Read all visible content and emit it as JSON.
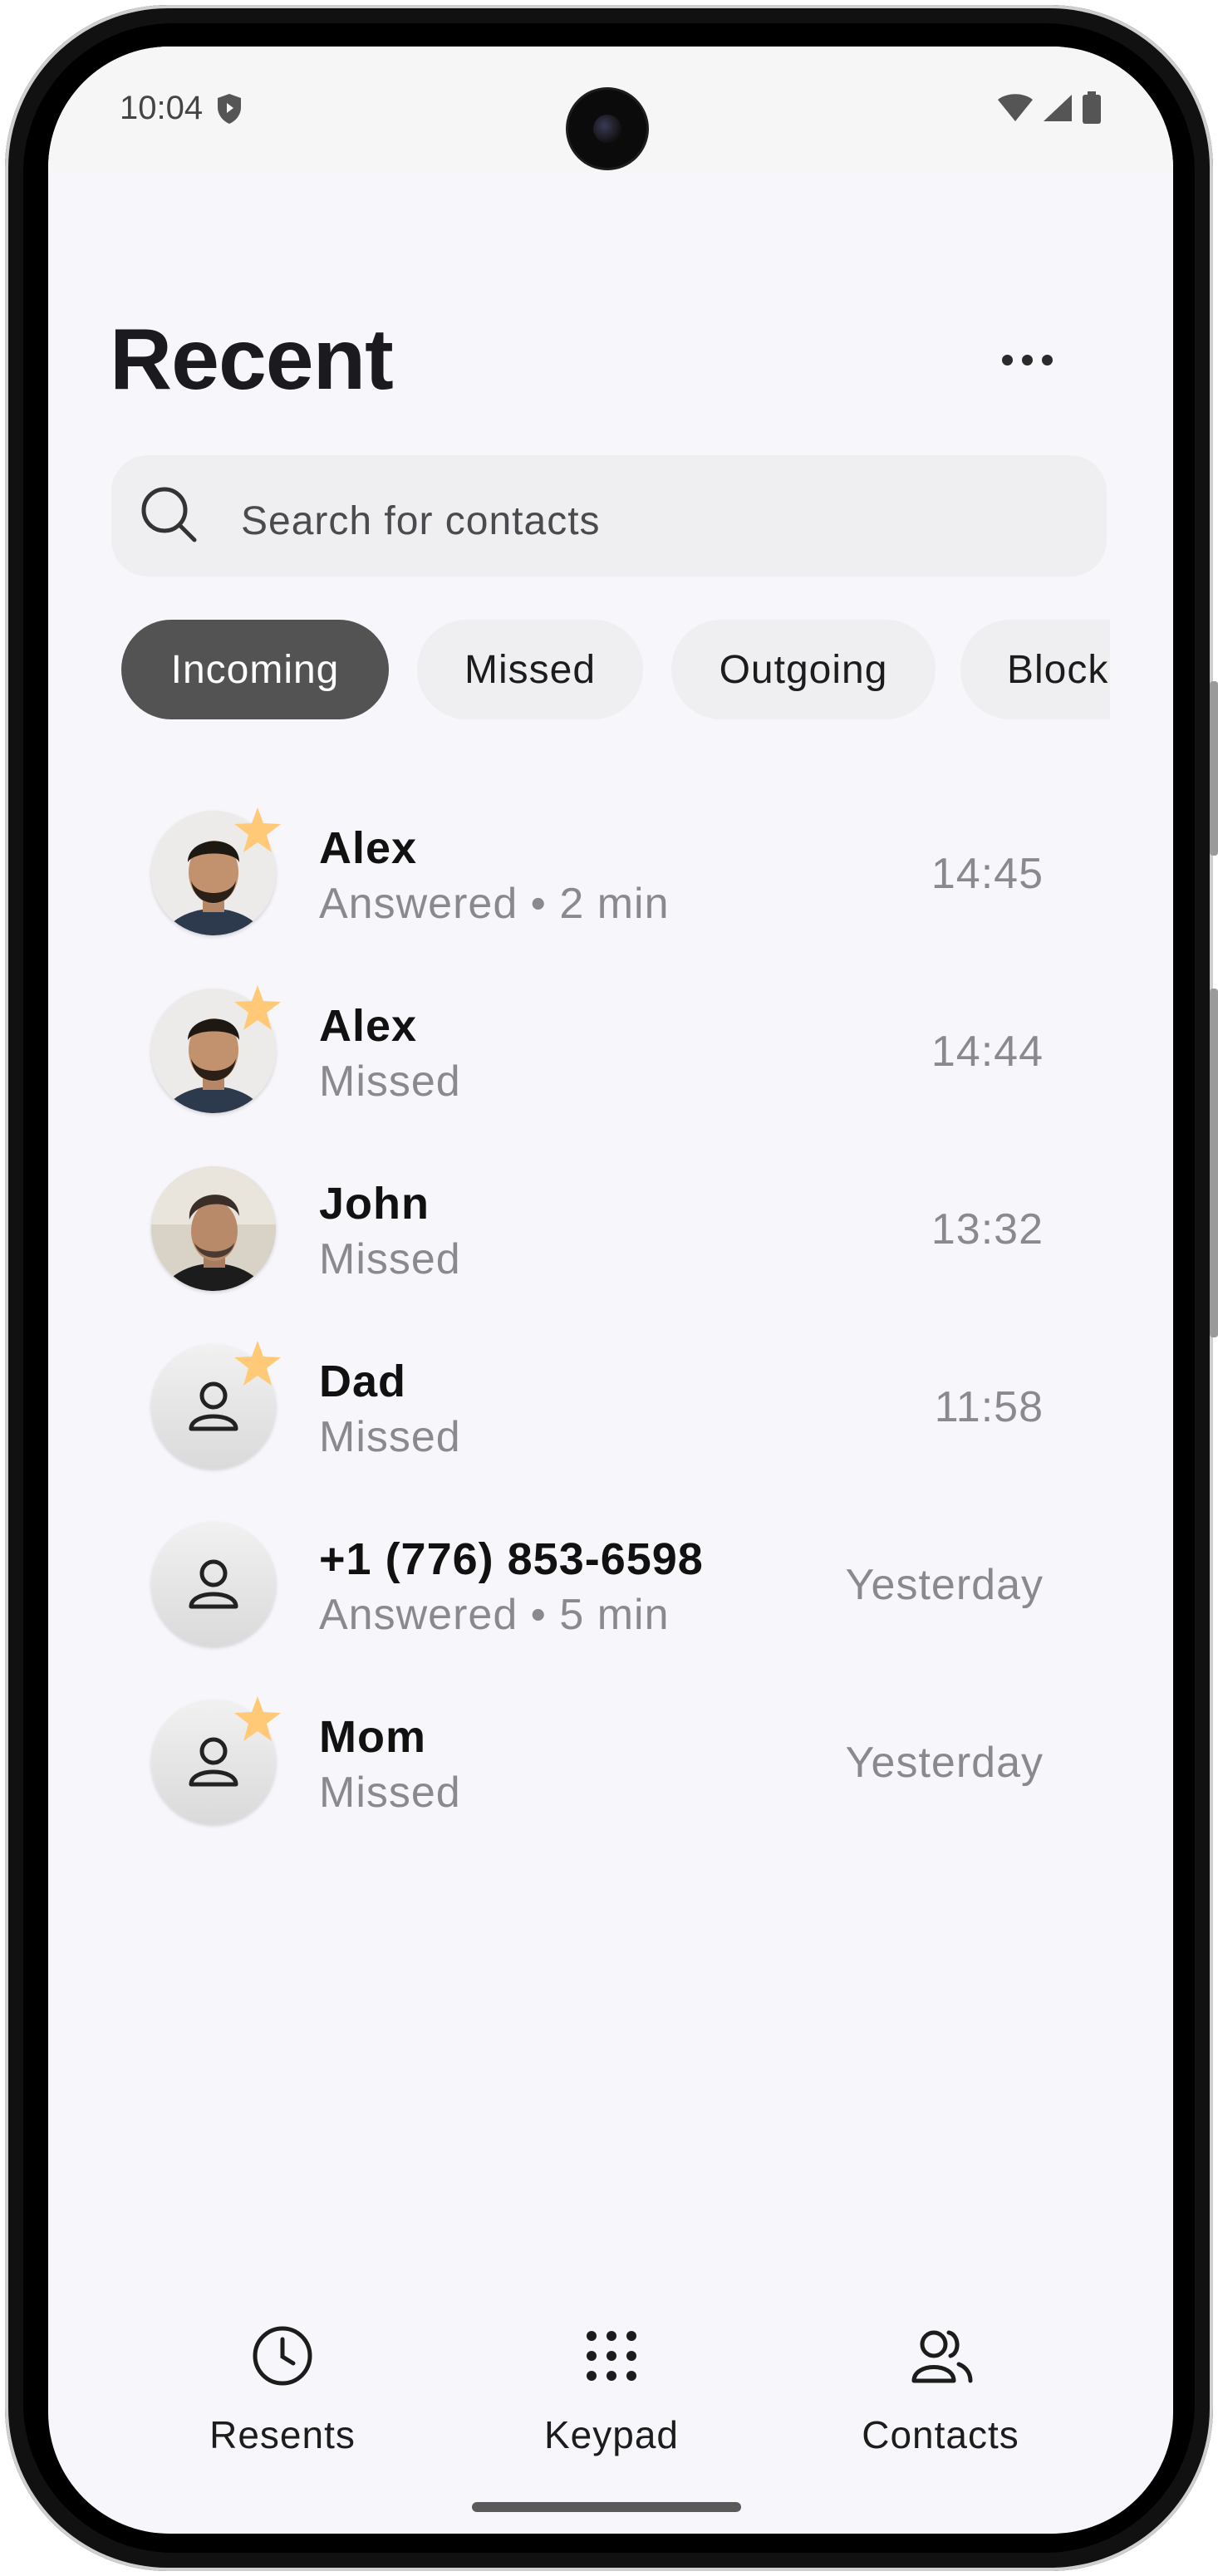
{
  "status_bar": {
    "time": "10:04"
  },
  "page_title": "Recent",
  "search": {
    "placeholder": "Search for contacts"
  },
  "filters": [
    {
      "label": "Incoming",
      "active": true
    },
    {
      "label": "Missed",
      "active": false
    },
    {
      "label": "Outgoing",
      "active": false
    },
    {
      "label": "Block",
      "active": false
    }
  ],
  "calls": [
    {
      "name": "Alex",
      "detail": "Answered • 2 min",
      "time": "14:45",
      "favorite": true,
      "avatar": "photo-alex"
    },
    {
      "name": "Alex",
      "detail": "Missed",
      "time": "14:44",
      "favorite": true,
      "avatar": "photo-alex"
    },
    {
      "name": "John",
      "detail": "Missed",
      "time": "13:32",
      "favorite": false,
      "avatar": "photo-john"
    },
    {
      "name": "Dad",
      "detail": "Missed",
      "time": "11:58",
      "favorite": true,
      "avatar": "placeholder"
    },
    {
      "name": "+1 (776) 853-6598",
      "detail": "Answered • 5 min",
      "time": "Yesterday",
      "favorite": false,
      "avatar": "placeholder"
    },
    {
      "name": "Mom",
      "detail": "Missed",
      "time": "Yesterday",
      "favorite": true,
      "avatar": "placeholder"
    }
  ],
  "bottom_nav": [
    {
      "label": "Resents",
      "icon": "clock-icon"
    },
    {
      "label": "Keypad",
      "icon": "keypad-icon"
    },
    {
      "label": "Contacts",
      "icon": "contacts-icon"
    }
  ],
  "colors": {
    "background": "#f7f6fb",
    "chip_active": "#535353",
    "favorite_star": "#ffc978",
    "muted_text": "#8a8a8e"
  }
}
